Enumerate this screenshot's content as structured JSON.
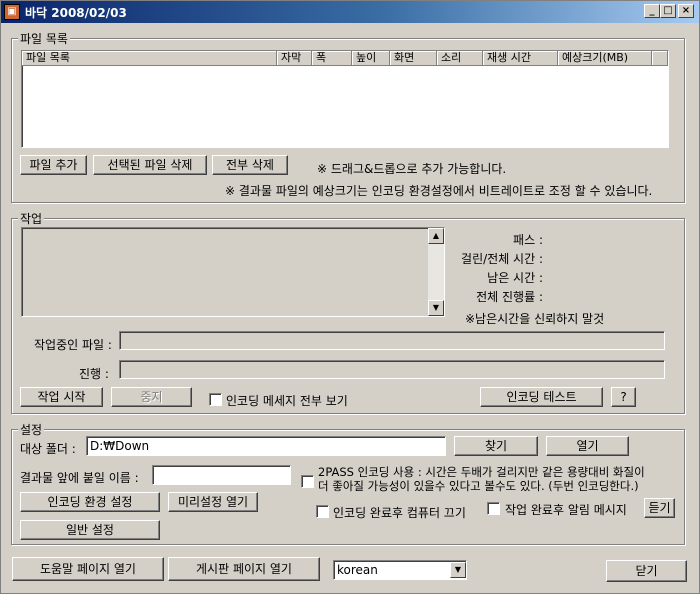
{
  "window": {
    "title": "바닥 2008/02/03",
    "app_icon": "app-icon"
  },
  "file_list": {
    "group_label": "파일 목록",
    "columns": [
      "파일 목록",
      "자막",
      "폭",
      "높이",
      "화면",
      "소리",
      "재생 시간",
      "예상크기(MB)"
    ],
    "add_button": "파일 추가",
    "delete_selected_button": "선택된 파일 삭제",
    "delete_all_button": "전부 삭제",
    "note_drag": "※ 드래그&드롭으로 추가 가능합니다.",
    "note_size": "※ 결과물 파일의 예상크기는 인코딩 환경설정에서 비트레이트로 조정 할 수 있습니다."
  },
  "job": {
    "group_label": "작업",
    "pass_label": "패스 :",
    "elapsed_label": "걸린/전체 시간 :",
    "remaining_label": "남은 시간 :",
    "total_progress_label": "전체 진행률 :",
    "remaining_note": "※남은시간을 신뢰하지 말것",
    "current_file_label": "작업중인 파일 :",
    "progress_label": "진행 :",
    "current_file_value": "",
    "progress_fraction": 0,
    "start_button": "작업 시작",
    "stop_button": "중지",
    "show_all_messages_label": "인코딩 메세지 전부 보기",
    "show_all_messages_checked": false,
    "encoding_test_button": "인코딩 테스트",
    "help_button": "?"
  },
  "settings": {
    "group_label": "설정",
    "target_folder_label": "대상 폴더 :",
    "target_folder_value": "D:₩Down",
    "browse_button": "찾기",
    "open_button": "열기",
    "prefix_label": "결과물 앞에 붙일 이름 :",
    "prefix_value": "",
    "twopass_line1": "2PASS 인코딩 사용 : 시간은 두배가 걸리지만 같은 용량대비 화질이",
    "twopass_line2": "더 좋아질 가능성이 있을수 있다고 볼수도 있다. (두번 인코딩한다.)",
    "twopass_checked": false,
    "encoding_settings_button": "인코딩 환경 설정",
    "preset_open_button": "미리설정 열기",
    "general_settings_button": "일반 설정",
    "shutdown_label": "인코딩 완료후 컴퓨터 끄기",
    "shutdown_checked": false,
    "notify_label": "작업 완료후 알림 메시지",
    "notify_checked": false,
    "listen_button": "듣기"
  },
  "footer": {
    "help_page_button": "도움말 페이지 열기",
    "board_page_button": "게시판 페이지 열기",
    "language_value": "korean",
    "close_button": "닫기"
  }
}
